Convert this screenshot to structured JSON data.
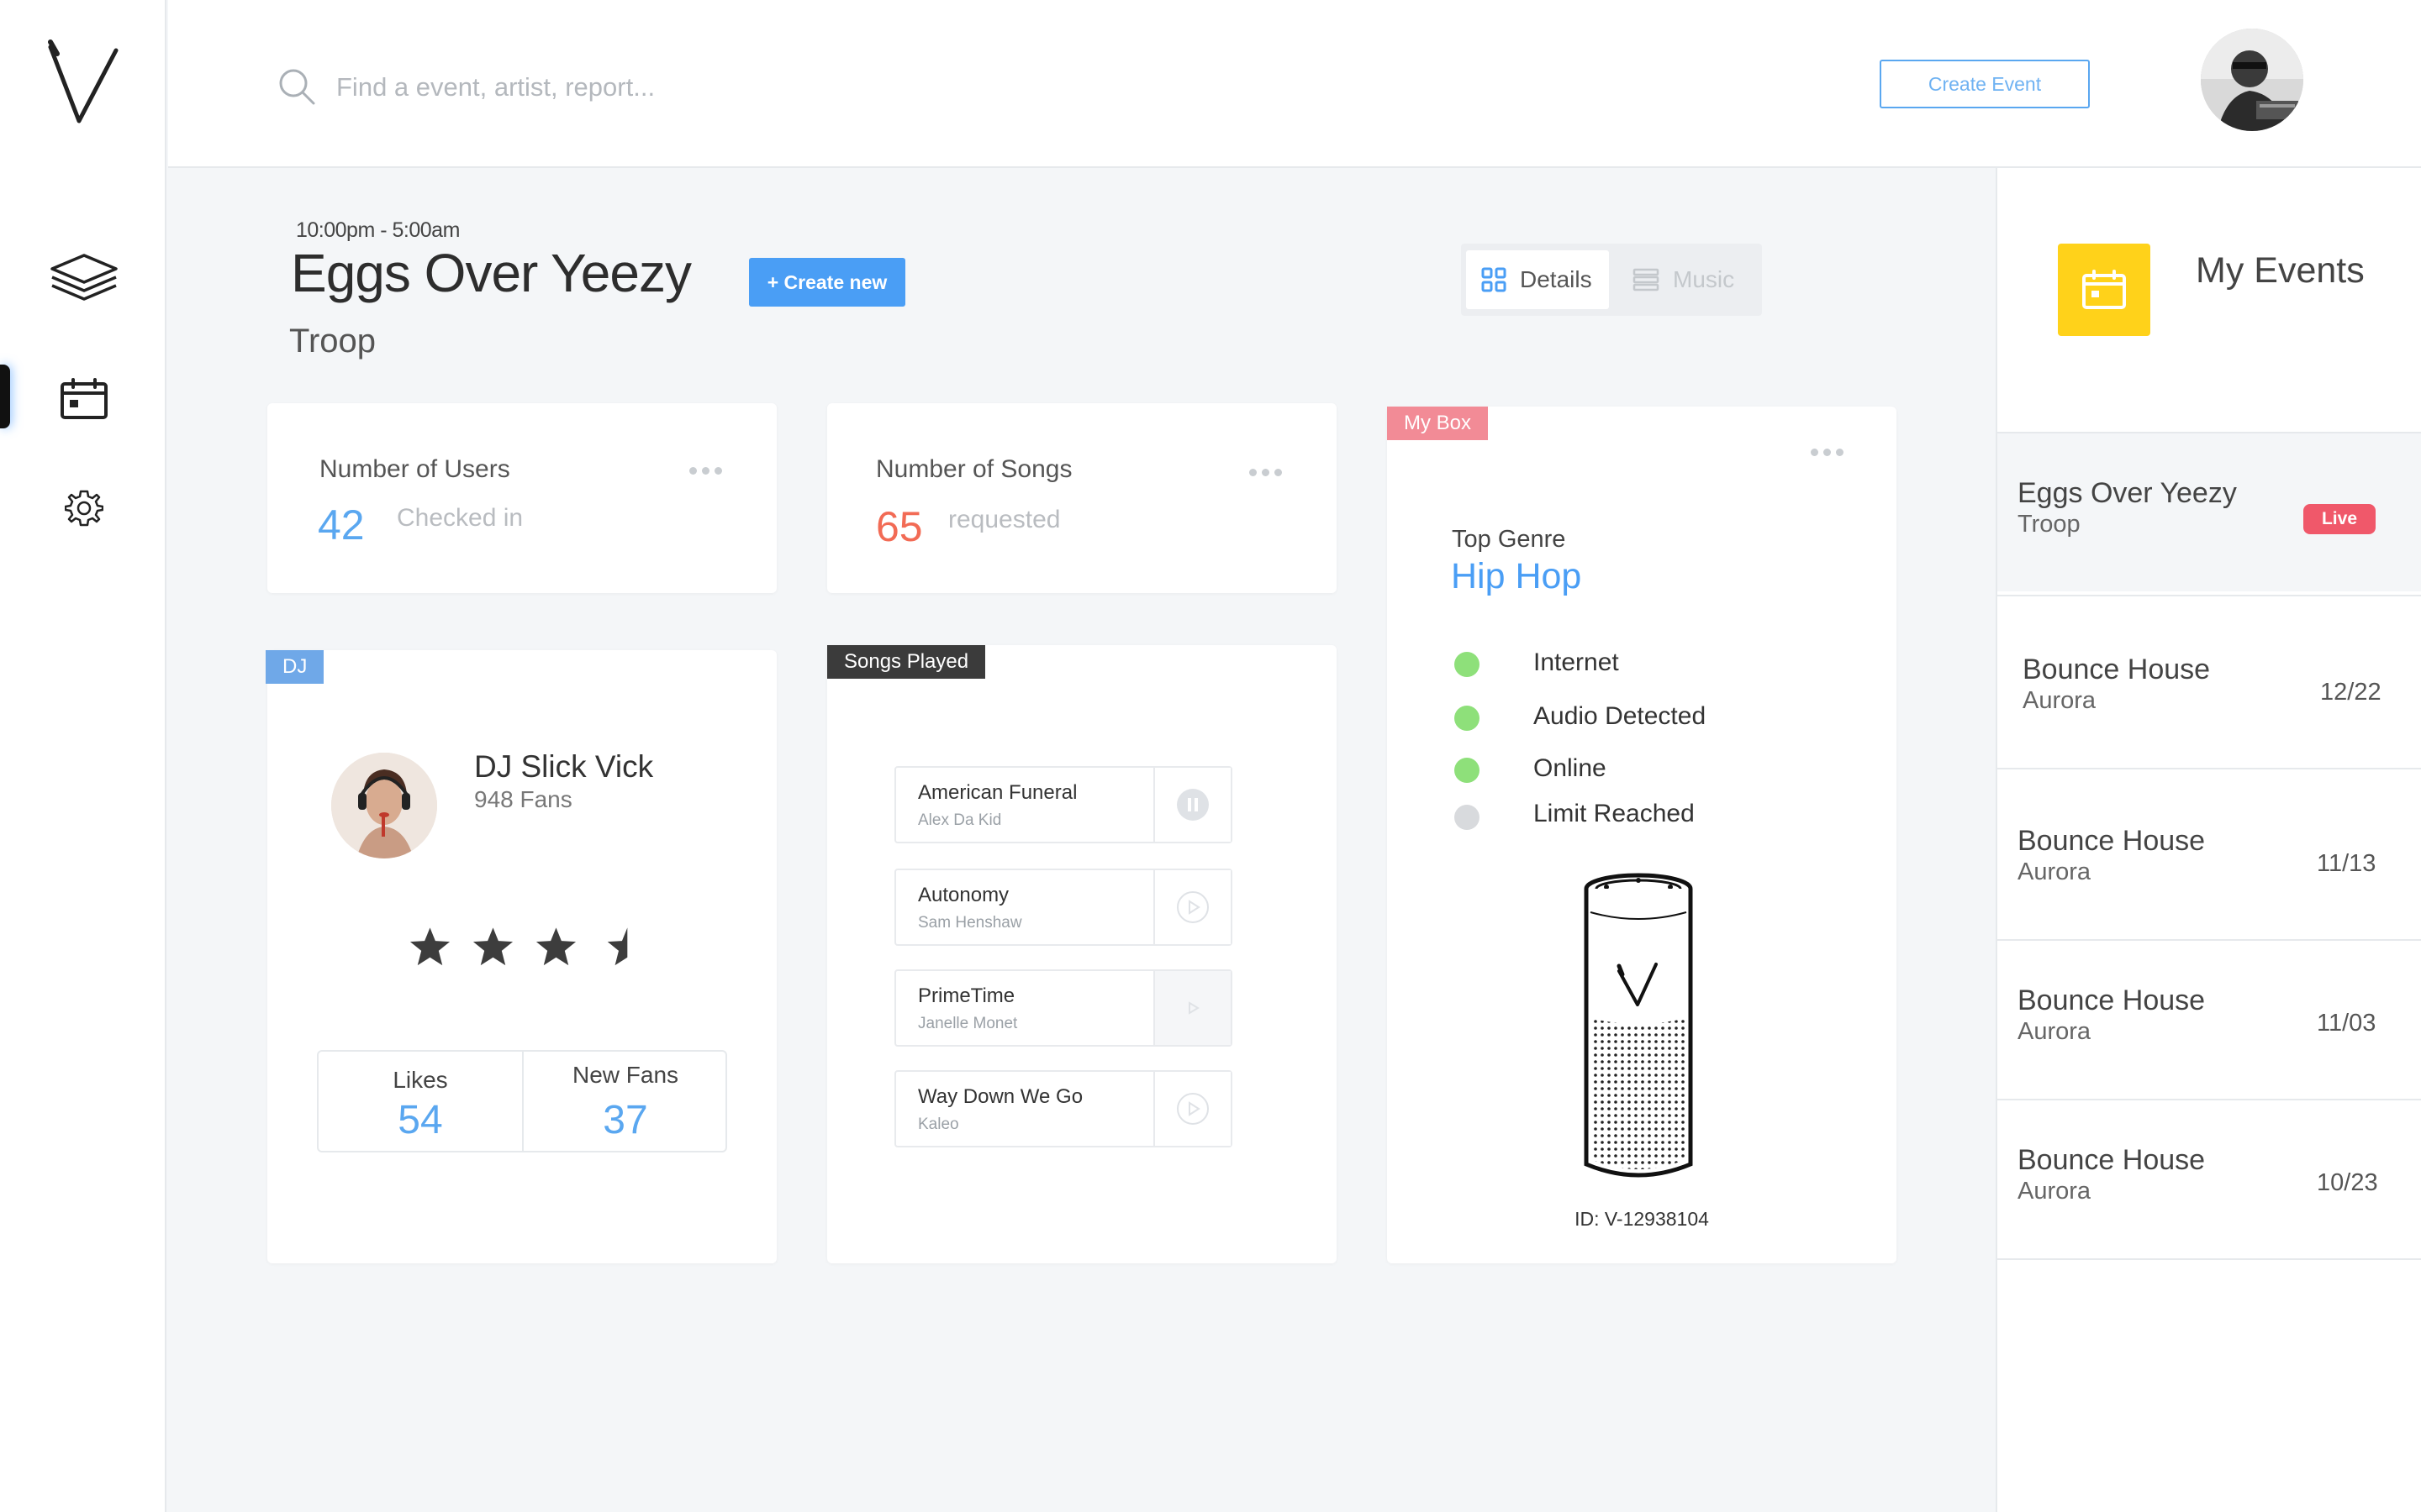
{
  "search": {
    "placeholder": "Find a event, artist, report..."
  },
  "header": {
    "create_event_label": "Create Event"
  },
  "event": {
    "time_range": "10:00pm - 5:00am",
    "title": "Eggs Over Yeezy",
    "venue": "Troop",
    "create_new_label": "+ Create new"
  },
  "view_toggle": {
    "details_label": "Details",
    "music_label": "Music",
    "active": "Details"
  },
  "users_card": {
    "label": "Number of Users",
    "value": "42",
    "sub": "Checked in"
  },
  "songs_card": {
    "label": "Number of Songs",
    "value": "65",
    "sub": "requested"
  },
  "dj_card": {
    "tag": "DJ",
    "name": "DJ Slick Vick",
    "fans": "948 Fans",
    "rating": 3.5,
    "likes_label": "Likes",
    "likes_value": "54",
    "new_fans_label": "New Fans",
    "new_fans_value": "37"
  },
  "songs_played": {
    "tag": "Songs Played",
    "songs": [
      {
        "title": "American Funeral",
        "artist": "Alex Da Kid",
        "control": "pause-icon"
      },
      {
        "title": "Autonomy",
        "artist": "Sam Henshaw",
        "control": "play-circle-icon"
      },
      {
        "title": "PrimeTime",
        "artist": "Janelle Monet",
        "control": "play-icon"
      },
      {
        "title": "Way Down We Go",
        "artist": "Kaleo",
        "control": "play-circle-icon"
      }
    ]
  },
  "box_card": {
    "tag": "My Box",
    "top_genre_label": "Top Genre",
    "top_genre_value": "Hip Hop",
    "statuses": [
      {
        "label": "Internet",
        "on": true
      },
      {
        "label": "Audio Detected",
        "on": true
      },
      {
        "label": "Online",
        "on": true
      },
      {
        "label": "Limit Reached",
        "on": false
      }
    ],
    "device_id": "ID: V-12938104"
  },
  "my_events": {
    "title": "My Events",
    "items": [
      {
        "name": "Eggs Over Yeezy",
        "venue": "Troop",
        "date": "",
        "badge": "Live"
      },
      {
        "name": "Bounce House",
        "venue": "Aurora",
        "date": "12/22",
        "badge": ""
      },
      {
        "name": "Bounce House",
        "venue": "Aurora",
        "date": "11/13",
        "badge": ""
      },
      {
        "name": "Bounce House",
        "venue": "Aurora",
        "date": "11/03",
        "badge": ""
      },
      {
        "name": "Bounce House",
        "venue": "Aurora",
        "date": "10/23",
        "badge": ""
      }
    ]
  },
  "colors": {
    "accent_blue": "#4a9ef5",
    "link_blue": "#5aa7f0",
    "users_number": "#5aa7f0",
    "songs_number": "#f26b55",
    "dj_tag": "#6fa8e8",
    "songs_tag": "#3b3b3b",
    "box_tag": "#f28b96",
    "status_on": "#8ee07a",
    "status_off": "#d8dadd",
    "live_badge": "#f0586a",
    "calendar_tile": "#ffd21a"
  }
}
